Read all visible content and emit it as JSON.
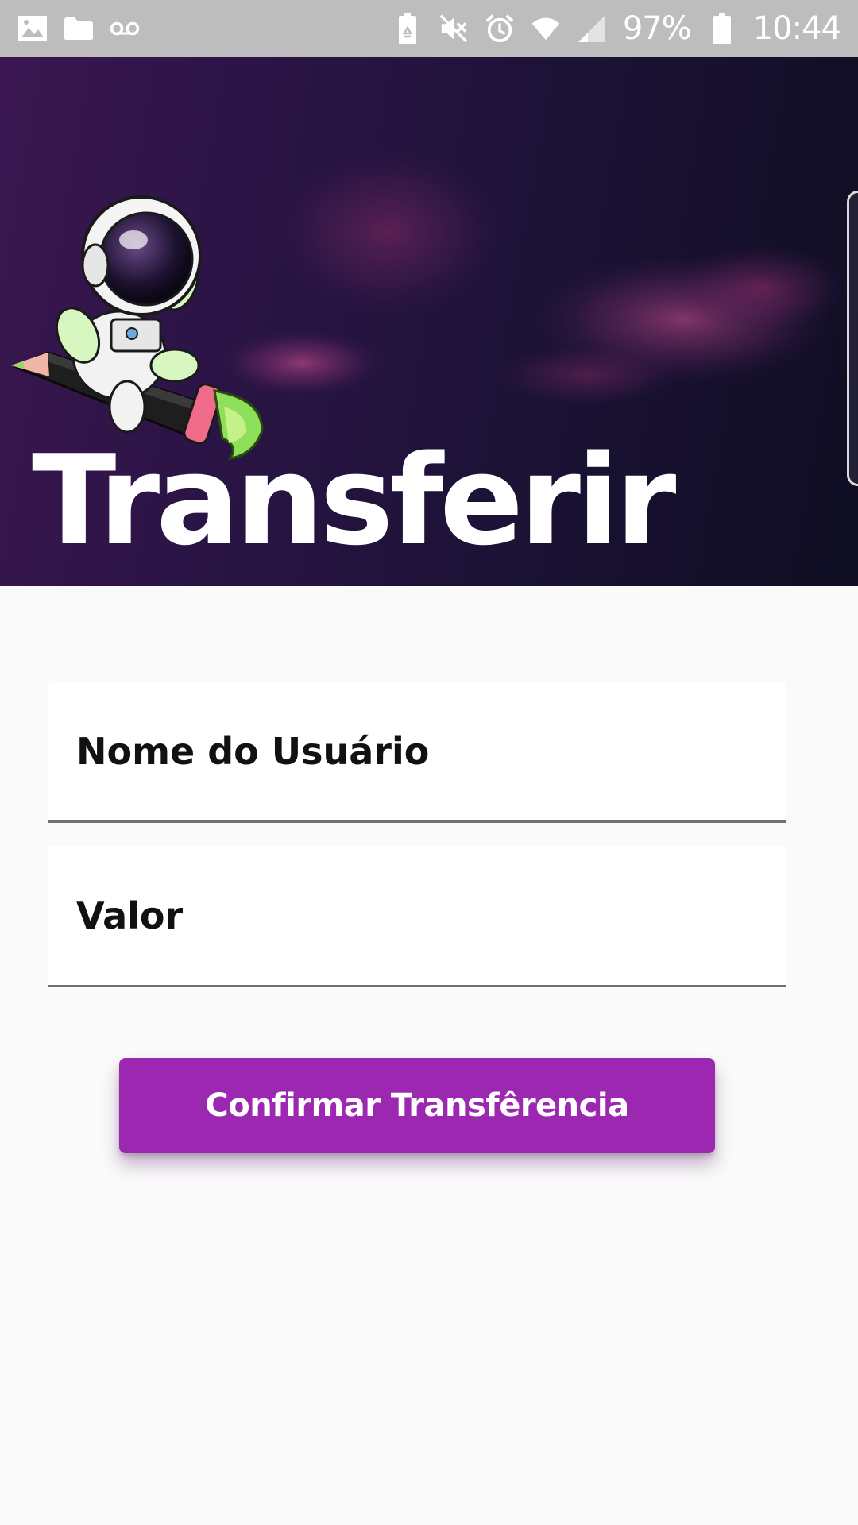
{
  "status_bar": {
    "left_icons": [
      "image-icon",
      "folder-icon",
      "voicemail-icon"
    ],
    "right_icons": [
      "battery-saver-icon",
      "mute-vibrate-icon",
      "alarm-icon",
      "wifi-icon",
      "signal-icon",
      "battery-icon"
    ],
    "battery_percent": "97%",
    "time": "10:44"
  },
  "hero": {
    "title": "Transferir",
    "illustration": "astronaut-on-pencil-rocket"
  },
  "form": {
    "username_placeholder": "Nome do Usuário",
    "value_placeholder": "Valor",
    "confirm_label": "Confirmar Transfêrencia"
  },
  "colors": {
    "accent": "#9c27b0",
    "status_bar": "#bdbdbd",
    "background": "#fafafa"
  }
}
